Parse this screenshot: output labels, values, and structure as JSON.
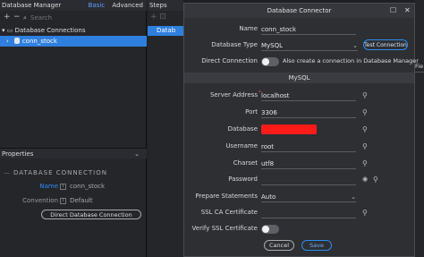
{
  "db_manager": {
    "title": "Database Manager",
    "tab_basic": "Basic",
    "tab_advanced": "Advanced",
    "search_placeholder": "Search",
    "tree_root": "Database Connections",
    "tree_item": "conn_stock"
  },
  "properties": {
    "title": "Properties",
    "section": "DATABASE CONNECTION",
    "name_label": "Name",
    "name_value": "conn_stock",
    "convention_label": "Convention",
    "convention_value": "Default",
    "direct_button": "Direct Database Connection"
  },
  "steps": {
    "title": "Steps",
    "item": "Datab"
  },
  "dialog": {
    "title": "Database Connector",
    "name_label": "Name",
    "name_value": "conn_stock",
    "dbtype_label": "Database Type",
    "dbtype_value": "MySQL",
    "test_button": "Test Connection",
    "direct_label": "Direct Connection",
    "direct_hint": "Also create a connection in Database Manager",
    "section": "MySQL",
    "server_label": "Server Address",
    "server_value": "localhost",
    "port_label": "Port",
    "port_value": "3306",
    "database_label": "Database",
    "username_label": "Username",
    "username_value": "root",
    "charset_label": "Charset",
    "charset_value": "utf8",
    "password_label": "Password",
    "prepare_label": "Prepare Statements",
    "prepare_value": "Auto",
    "sslca_label": "SSL CA Certificate",
    "verify_label": "Verify SSL Certificate",
    "cancel_button": "Cancel",
    "save_button": "Save"
  },
  "right_strip": {
    "text": "Fie"
  },
  "colors": {
    "accent": "#2f7fde",
    "redaction": "#ff1a1a",
    "dialog_bg": "#2d2f33"
  }
}
